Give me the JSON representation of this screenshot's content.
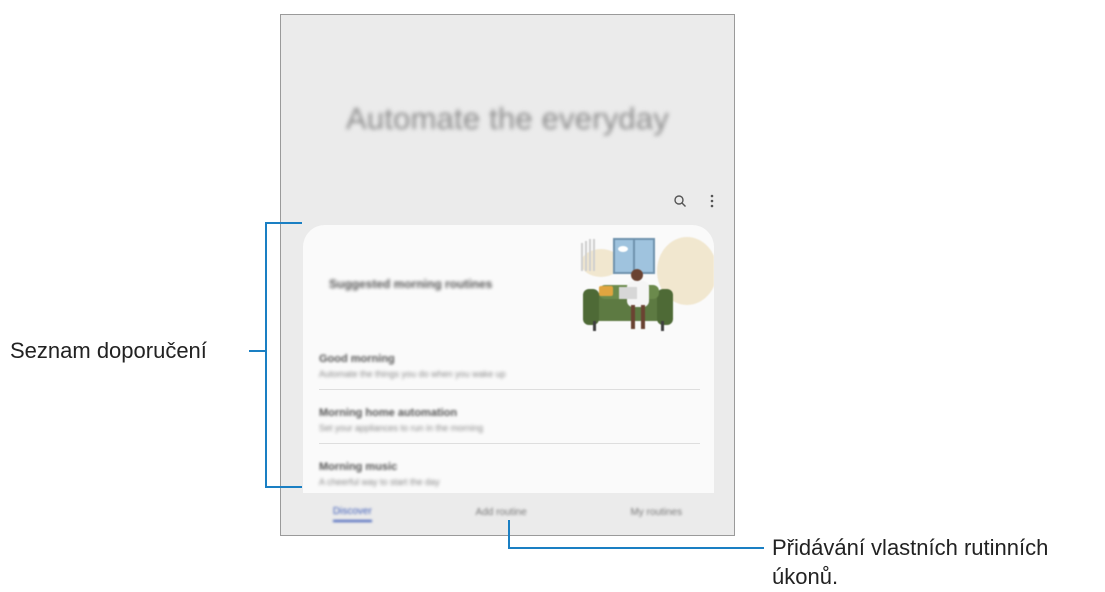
{
  "screen": {
    "hero_title": "Automate the everyday",
    "toolbar": {
      "icons": [
        "search-icon",
        "more-options-icon"
      ]
    },
    "card": {
      "title": "Suggested morning routines",
      "routines": [
        {
          "title": "Good morning",
          "subtitle": "Automate the things you do when you wake up"
        },
        {
          "title": "Morning home automation",
          "subtitle": "Set your appliances to run in the morning"
        },
        {
          "title": "Morning music",
          "subtitle": "A cheerful way to start the day"
        }
      ]
    },
    "bottom_nav": [
      {
        "label": "Discover",
        "active": true
      },
      {
        "label": "Add routine",
        "active": false
      },
      {
        "label": "My routines",
        "active": false
      }
    ]
  },
  "callouts": {
    "recommendations_label": "Seznam doporučení",
    "add_custom_line1": "Přidávání vlastních rutinních",
    "add_custom_line2": "úkonů."
  },
  "colors": {
    "callout_line": "#1a7fc3",
    "active_tab": "#3a5ab8"
  }
}
